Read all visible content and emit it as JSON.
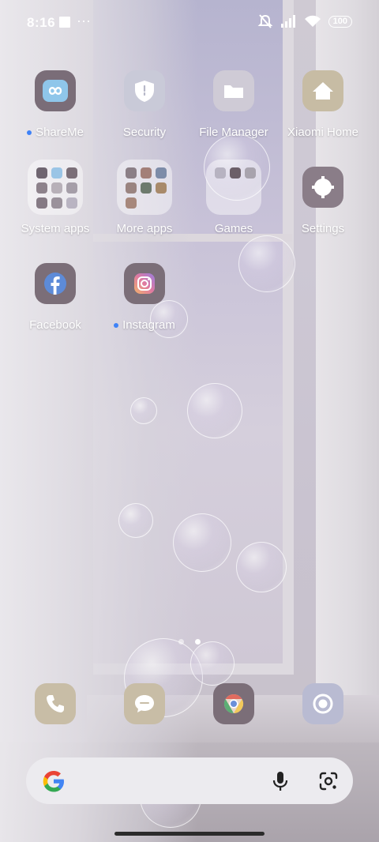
{
  "status_bar": {
    "time": "8:16",
    "battery": "100",
    "icons": [
      "notification-square",
      "more-dots",
      "mute-icon",
      "signal-icon",
      "wifi-icon",
      "battery-icon"
    ]
  },
  "apps": {
    "shareme": {
      "label": "ShareMe",
      "new_dot": true,
      "icon": "infinity-icon"
    },
    "security": {
      "label": "Security",
      "icon": "shield-icon"
    },
    "file_manager": {
      "label": "File Manager",
      "icon": "folder-icon"
    },
    "xiaomi_home": {
      "label": "Xiaomi Home",
      "icon": "house-icon"
    },
    "system_apps": {
      "label": "System apps",
      "icon": "folder-grid"
    },
    "more_apps": {
      "label": "More apps",
      "icon": "folder-grid"
    },
    "games": {
      "label": "Games",
      "icon": "folder-grid"
    },
    "settings": {
      "label": "Settings",
      "icon": "gear-icon"
    },
    "facebook": {
      "label": "Facebook",
      "icon": "facebook-icon"
    },
    "instagram": {
      "label": "Instagram",
      "new_dot": true,
      "icon": "instagram-icon"
    }
  },
  "dock": [
    {
      "name": "phone",
      "icon": "phone-icon"
    },
    {
      "name": "messages",
      "icon": "message-icon"
    },
    {
      "name": "chrome",
      "icon": "chrome-icon"
    },
    {
      "name": "camera",
      "icon": "camera-icon"
    }
  ],
  "page_indicator": {
    "pages": 2,
    "current": 2
  },
  "search_bar": {
    "icons": [
      "google-logo",
      "microphone-icon",
      "lens-icon"
    ]
  },
  "colors": {
    "icon_tile_mauve": "#7b6e78",
    "icon_tile_beige": "#c8bda6",
    "notification_dot": "#3e82f7",
    "search_bg": "#ecebef"
  }
}
